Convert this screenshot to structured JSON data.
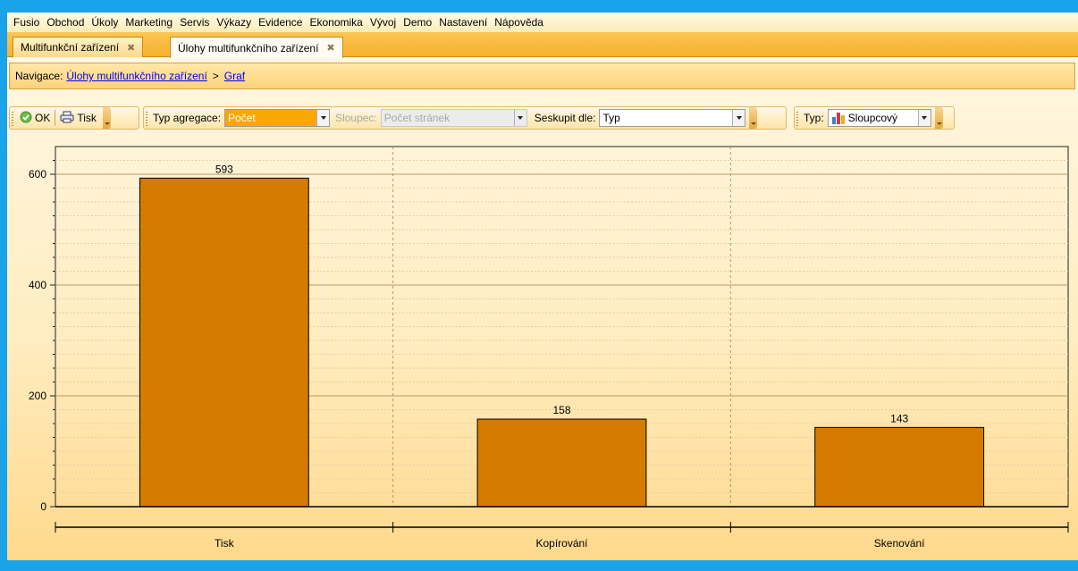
{
  "menu": [
    "Fusio",
    "Obchod",
    "Úkoly",
    "Marketing",
    "Servis",
    "Výkazy",
    "Evidence",
    "Ekonomika",
    "Vývoj",
    "Demo",
    "Nastavení",
    "Nápověda"
  ],
  "tabs": [
    {
      "label": "Multifunkční zařízení",
      "close": "✖"
    },
    {
      "label": "Úlohy multifunkčního zařízení",
      "close": "✖"
    }
  ],
  "navigation": {
    "label": "Navigace:",
    "link1": "Úlohy multifunkčního zařízení",
    "separator": ">",
    "link2": "Graf"
  },
  "toolbar": {
    "ok_label": "OK",
    "print_label": "Tisk",
    "aggregation_label": "Typ agregace:",
    "aggregation_value": "Počet",
    "column_label": "Sloupec:",
    "column_value": "Počet stránek",
    "group_label": "Seskupit dle:",
    "group_value": "Typ",
    "type_label": "Typ:",
    "type_value": "Sloupcový"
  },
  "colors": {
    "bar": "#d47b00",
    "accent": "#1aa3e8",
    "selection": "#f9a800"
  },
  "chart_data": {
    "type": "bar",
    "categories": [
      "Tisk",
      "Kopírování",
      "Skenování"
    ],
    "values": [
      593,
      158,
      143
    ],
    "ylim": [
      0,
      650
    ],
    "yticks": [
      0,
      200,
      400,
      600
    ],
    "data_labels": true,
    "grid": true,
    "title": "",
    "xlabel": "",
    "ylabel": ""
  }
}
